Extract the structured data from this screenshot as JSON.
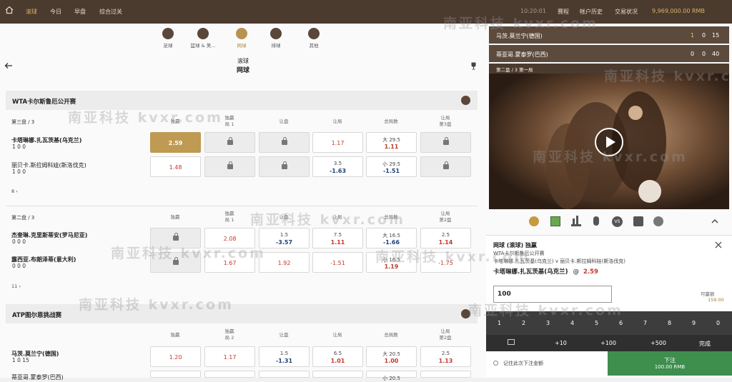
{
  "topnav": {
    "tabs": [
      "滚球",
      "今日",
      "早盘",
      "综合过关"
    ],
    "time": "10:20:01",
    "links": [
      "赛程",
      "帐户历史",
      "交易状况"
    ],
    "balance": "9,969,000.00 RMB"
  },
  "sports": [
    {
      "label": "足球"
    },
    {
      "label": "篮球 & 美..."
    },
    {
      "label": "网球"
    },
    {
      "label": "排球"
    },
    {
      "label": "其他"
    }
  ],
  "page": {
    "title1": "滚球",
    "title2": "网球"
  },
  "leagues": [
    {
      "name": "WTA卡尔斯鲁厄公开赛",
      "period": "第三盘 / 3",
      "cols": [
        "独赢",
        "独赢\n局 1",
        "让盘",
        "让局",
        "总局数",
        "让局\n第3盘"
      ],
      "teams": [
        {
          "name": "卡塔琳娜.扎瓦茨基(乌克兰)",
          "score": "1   0   0"
        },
        {
          "name": "丽贝卡.斯拉姆科娃(斯洛伐克)",
          "score": "1   0   0"
        }
      ],
      "odds": [
        [
          {
            "v": "2.59"
          },
          {
            "lock": true
          },
          {
            "lock": true
          },
          {
            "v": "1.17"
          },
          {
            "a": "大 29.5",
            "b": "1.11"
          },
          {
            "lock": true
          }
        ],
        [
          {
            "v": "1.48"
          },
          {
            "lock": true
          },
          {
            "lock": true
          },
          {
            "a": "3.5",
            "b": "-1.63"
          },
          {
            "a": "小 29.5",
            "b": "-1.51"
          },
          {
            "lock": true
          }
        ]
      ],
      "more": "8 ›"
    },
    {
      "name": "",
      "period": "第二盘 / 3",
      "cols": [
        "独赢",
        "独赢\n局 1",
        "让盘",
        "让局",
        "总局数",
        "让局\n第2盘"
      ],
      "teams": [
        {
          "name": "杰奎琳.克里斯蒂安(罗马尼亚)",
          "score": "0   0   0"
        },
        {
          "name": "露西亚.布朗泽蒂(意大利)",
          "score": "0   0   0"
        }
      ],
      "odds": [
        [
          {
            "lock": true
          },
          {
            "v": "2.08"
          },
          {
            "a": "1.5",
            "b": "-3.57"
          },
          {
            "a": "7.5",
            "b": "1.11"
          },
          {
            "a": "大 16.5",
            "b": "-1.66"
          },
          {
            "a": "2.5",
            "b": "1.14"
          }
        ],
        [
          {
            "lock": true
          },
          {
            "v": "1.67"
          },
          {
            "v": "1.92"
          },
          {
            "v": "-1.51"
          },
          {
            "a": "小 16.5",
            "b": "1.19"
          },
          {
            "v": "-1.75"
          }
        ]
      ],
      "more": "11 ›"
    },
    {
      "name": "ATP图尔恩挑战赛",
      "period": "",
      "cols": [
        "独赢",
        "独赢\n局 2",
        "让盘",
        "让局",
        "总局数",
        "让局\n第2盘"
      ],
      "teams": [
        {
          "name": "马茨.莫兰宁(德国)",
          "score": "1   0   15"
        },
        {
          "name": "蒂亚哥.蒙泰罗(巴西)",
          "score": ""
        }
      ],
      "odds": [
        [
          {
            "v": "1.20"
          },
          {
            "v": "1.17"
          },
          {
            "a": "1.5",
            "b": "-1.31"
          },
          {
            "a": "6.5",
            "b": "1.01"
          },
          {
            "a": "大 20.5",
            "b": "1.00"
          },
          {
            "a": "2.5",
            "b": "1.13"
          }
        ],
        [
          {
            "v": ""
          },
          {
            "v": ""
          },
          {
            "v": ""
          },
          {
            "v": ""
          },
          {
            "a": "小 20.5",
            "b": ""
          },
          {
            "v": ""
          }
        ]
      ],
      "more": ""
    }
  ],
  "live": {
    "teamA": "马茨.莫兰宁(德国)",
    "a": [
      "1",
      "0",
      "15"
    ],
    "teamB": "蒂亚哥.蒙泰罗(巴西)",
    "b": [
      "0",
      "0",
      "40"
    ],
    "period": "第二盘 / 3  第一局"
  },
  "betslip": {
    "header": "网球 (滚球) 独赢",
    "league": "WTA卡尔斯鲁厄公开赛",
    "match": "卡塔琳娜.扎瓦茨基(乌克兰) v 丽贝卡.斯拉姆科娃(斯洛伐克)",
    "pick": "卡塔琳娜.扎瓦茨基(乌克兰)",
    "at": "@",
    "odds": "2.59",
    "stake": "100",
    "maxLabel": "可赢额",
    "max": "159.00",
    "keys": [
      "1",
      "2",
      "3",
      "4",
      "5",
      "6",
      "7",
      "8",
      "9",
      "0"
    ],
    "quick": [
      "+10",
      "+100",
      "+500",
      "完成"
    ],
    "remember": "记住此次下注金额",
    "place": "下注",
    "placeAmt": "100.00 RMB"
  },
  "watermark": "南亚科技 kvxr.com"
}
